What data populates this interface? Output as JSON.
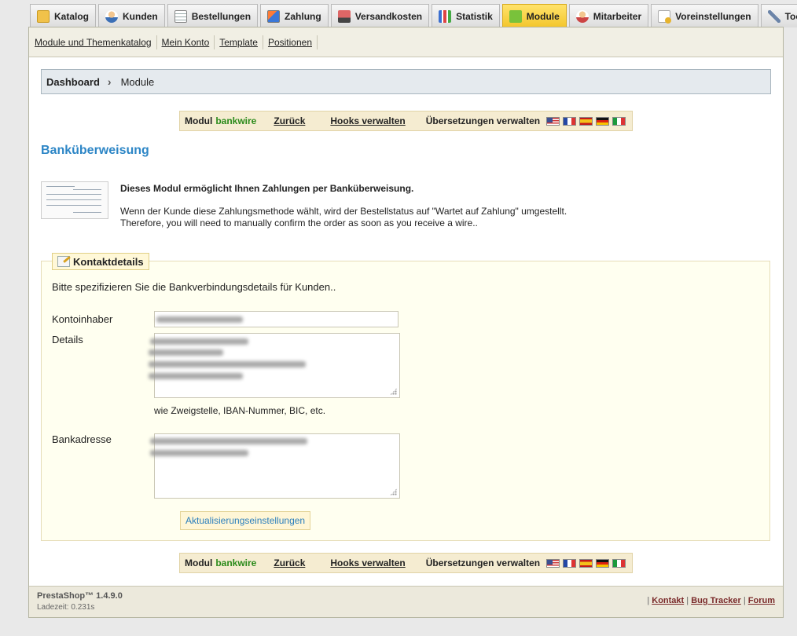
{
  "tabs": [
    {
      "label": "Katalog",
      "icon": "folder-icon"
    },
    {
      "label": "Kunden",
      "icon": "user-icon"
    },
    {
      "label": "Bestellungen",
      "icon": "document-icon"
    },
    {
      "label": "Zahlung",
      "icon": "payment-card-icon"
    },
    {
      "label": "Versandkosten",
      "icon": "truck-icon"
    },
    {
      "label": "Statistik",
      "icon": "bar-chart-icon"
    },
    {
      "label": "Module",
      "icon": "puzzle-icon",
      "active": true
    },
    {
      "label": "Mitarbeiter",
      "icon": "employee-icon"
    },
    {
      "label": "Voreinstellungen",
      "icon": "preferences-icon"
    },
    {
      "label": "Tools",
      "icon": "wrench-icon"
    }
  ],
  "subnav": [
    "Module und Themenkatalog",
    "Mein Konto",
    "Template",
    "Positionen"
  ],
  "breadcrumb": {
    "home": "Dashboard",
    "current": "Module"
  },
  "toolbar": {
    "module_label": "Modul",
    "module_name": "bankwire",
    "back": "Zurück",
    "hooks": "Hooks verwalten",
    "translations": "Übersetzungen verwalten"
  },
  "page_title": "Banküberweisung",
  "intro": {
    "headline": "Dieses Modul ermöglicht Ihnen Zahlungen per Banküberweisung.",
    "line1": "Wenn der Kunde diese Zahlungsmethode wählt, wird der Bestellstatus auf \"Wartet auf Zahlung\" umgestellt.",
    "line2": "Therefore, you will need to manually confirm the order as soon as you receive a wire.."
  },
  "form": {
    "legend": "Kontaktdetails",
    "description": "Bitte spezifizieren Sie die Bankverbindungsdetails für Kunden..",
    "owner_label": "Kontoinhaber",
    "details_label": "Details",
    "details_hint": "wie Zweigstelle, IBAN-Nummer, BIC, etc.",
    "address_label": "Bankadresse",
    "submit": "Aktualisierungseinstellungen"
  },
  "footer": {
    "version": "PrestaShop™ 1.4.9.0",
    "load_time": "Ladezeit: 0.231s",
    "links": [
      "Kontakt",
      "Bug Tracker",
      "Forum"
    ]
  }
}
